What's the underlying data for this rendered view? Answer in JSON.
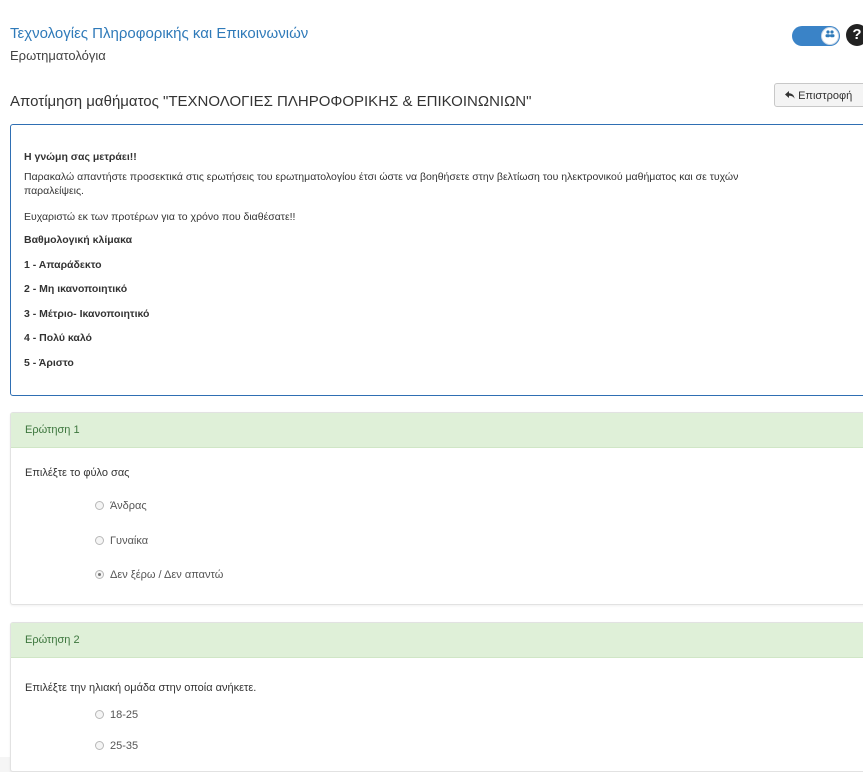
{
  "header": {
    "course_title": "Τεχνολογίες Πληροφορικής και Επικοινωνιών",
    "module": "Ερωτηματολόγια",
    "toggle_icon": "users-icon",
    "help_label": "?"
  },
  "page": {
    "heading": "Αποτίμηση μαθήματος \"ΤΕΧΝΟΛΟΓΙΕΣ ΠΛΗΡΟΦΟΡΙΚΗΣ & ΕΠΙΚΟΙΝΩΝΙΩΝ\"",
    "back_label": "Επιστροφή",
    "back_icon": "reply-arrow-icon"
  },
  "intro": {
    "title": "Η γνώμη σας μετράει!!",
    "line1": "Παρακαλώ απαντήστε προσεκτικά στις ερωτήσεις του ερωτηματολογίου έτσι ώστε να βοηθήσετε στην βελτίωση του ηλεκτρονικού μαθήματος και σε τυχών",
    "line2": "παραλείψεις.",
    "thanks": "Ευχαριστώ εκ των προτέρων για το χρόνο που διαθέσατε!!",
    "scale_title": "Βαθμολογική κλίμακα",
    "scale": [
      "1 - Απαράδεκτο",
      "2 - Μη ικανοποιητικό",
      "3 - Μέτριο- Ικανοποιητικό",
      "4 - Πολύ καλό",
      "5 - Άριστο"
    ]
  },
  "questions": [
    {
      "header": "Ερώτηση 1",
      "text": "Επιλέξτε το φύλο σας",
      "options": [
        "Άνδρας",
        "Γυναίκα",
        "Δεν ξέρω / Δεν απαντώ"
      ],
      "selected_index": 2
    },
    {
      "header": "Ερώτηση 2",
      "text": "Επιλέξτε την ηλιακή ομάδα στην οποία ανήκετε.",
      "options": [
        "18-25",
        "25-35"
      ],
      "selected_index": null
    }
  ],
  "colors": {
    "link_blue": "#2f7ab9",
    "panel_border": "#2f6fb3",
    "question_header_bg": "#dff0d8",
    "question_header_text": "#3c763d"
  }
}
